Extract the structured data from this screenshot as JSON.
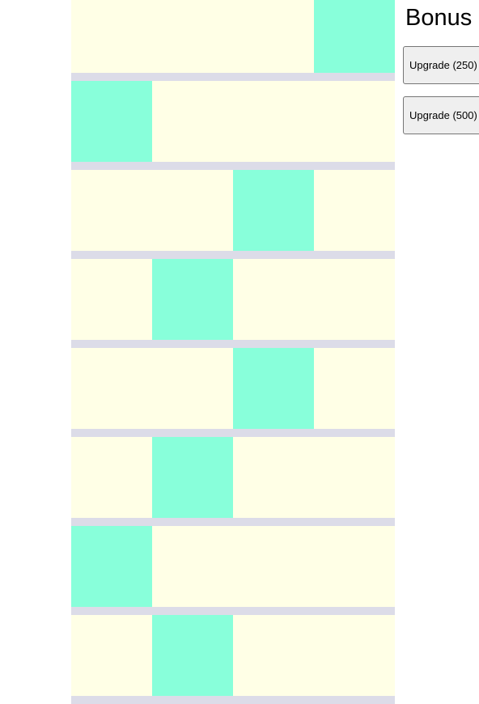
{
  "sidebar": {
    "title": "Bonus",
    "buttons": [
      {
        "label": "Upgrade (250)"
      },
      {
        "label": "Upgrade (500)"
      }
    ]
  },
  "board": {
    "columns": 4,
    "active_columns": [
      3,
      0,
      2,
      1,
      2,
      1,
      0,
      1
    ],
    "colors": {
      "tile": "#ffffe6",
      "active_tile": "#88ffda",
      "row_divider": "#dcdce8"
    }
  }
}
